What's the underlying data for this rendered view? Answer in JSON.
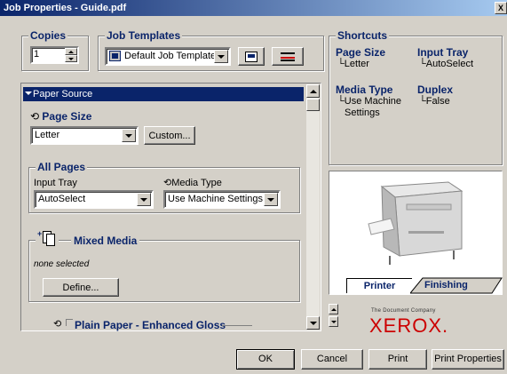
{
  "window": {
    "title": "Job Properties - Guide.pdf",
    "close_glyph": "X"
  },
  "copies": {
    "label": "Copies",
    "value": "1"
  },
  "job_templates": {
    "label": "Job Templates",
    "selected": "Default Job Templates"
  },
  "shortcuts": {
    "label": "Shortcuts",
    "page_size": {
      "title": "Page Size",
      "value": "Letter"
    },
    "input_tray": {
      "title": "Input Tray",
      "value": "AutoSelect"
    },
    "media_type": {
      "title": "Media Type",
      "value_line1": "Use Machine",
      "value_line2": "Settings"
    },
    "duplex": {
      "title": "Duplex",
      "value": "False"
    }
  },
  "panel": {
    "header": "Paper Source",
    "page_size_label": "Page Size",
    "page_size_value": "Letter",
    "custom_button": "Custom...",
    "all_pages_label": "All Pages",
    "input_tray_label": "Input Tray",
    "input_tray_value": "AutoSelect",
    "media_type_label": "Media Type",
    "media_type_value": "Use Machine Settings",
    "mixed_media_label": "Mixed Media",
    "mixed_media_status": "none selected",
    "define_button": "Define...",
    "plain_paper_label": "Plain Paper - Enhanced Gloss"
  },
  "preview": {
    "tab_printer": "Printer",
    "tab_finishing": "Finishing"
  },
  "brand": {
    "tagline": "The Document Company",
    "logo": "XEROX.",
    "color": "#cc0000"
  },
  "buttons": {
    "ok": "OK",
    "cancel": "Cancel",
    "print": "Print",
    "print_properties": "Print Properties"
  },
  "colors": {
    "accent": "#0a246a",
    "face": "#d4d0c8"
  }
}
